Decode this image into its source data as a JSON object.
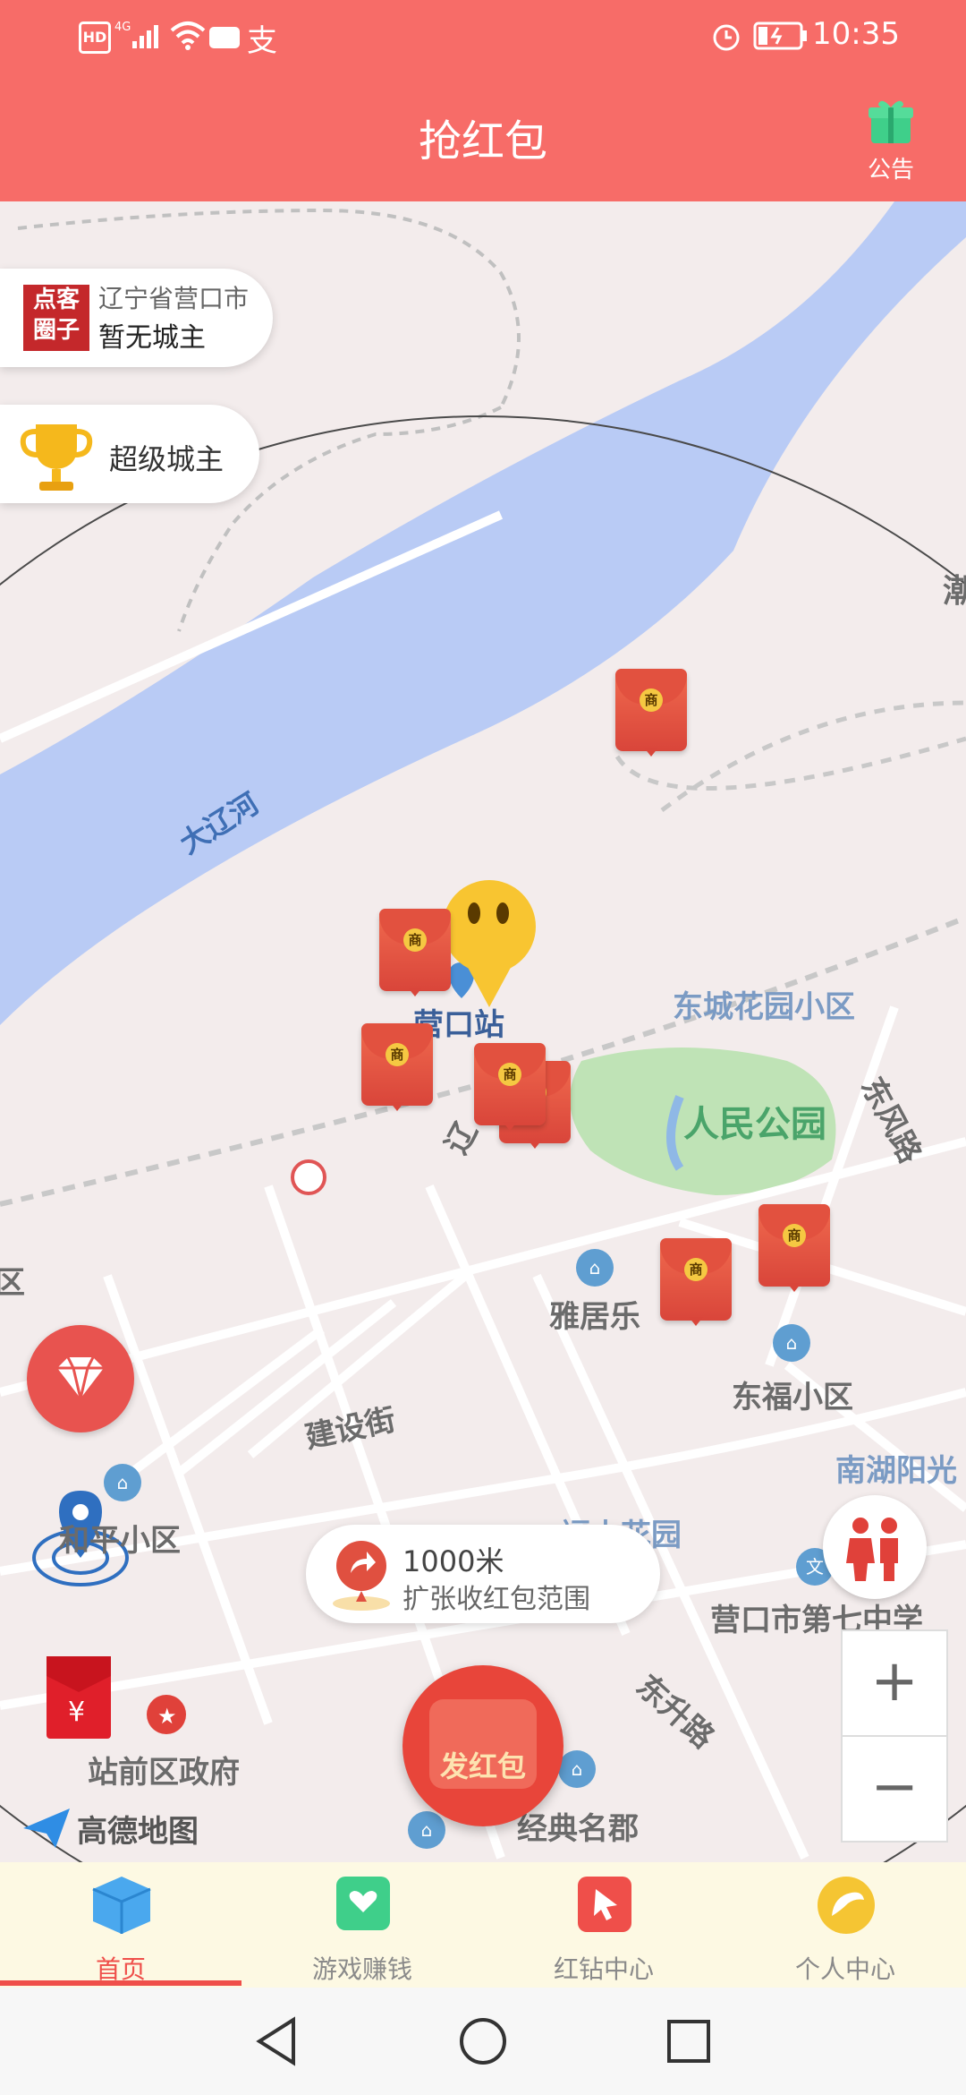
{
  "status_bar": {
    "left_icons": [
      "hd-icon",
      "4g-signal-icon",
      "wifi-icon",
      "huawei-icon",
      "alipay-icon"
    ],
    "right_icons": [
      "alarm-icon",
      "battery-icon"
    ],
    "time": "10:35"
  },
  "header": {
    "title": "抢红包",
    "notice_label": "公告"
  },
  "city_card": {
    "logo_text": "点客圈子",
    "location": "辽宁省营口市",
    "owner_status": "暂无城主"
  },
  "super_card": {
    "label": "超级城主"
  },
  "map_labels": {
    "river": "大辽河",
    "station": "营口站",
    "east_city": "东城花园小区",
    "park": "人民公园",
    "dongfeng_road": "东风路",
    "yajule": "雅居乐",
    "dongfu": "东福小区",
    "jianshe": "建设街",
    "nanhu": "南湖阳光",
    "fushan": "福山花园",
    "heping": "和平小区",
    "no7school": "营口市第七中学",
    "zhanqian": "站前区政府",
    "dongsheng": "东升路",
    "jingdian": "经典名郡",
    "liao": "辽",
    "edge_chao": "潮",
    "edge_qu": "区",
    "amap": "高德地图"
  },
  "envelope_badge": "商",
  "range_bubble": {
    "distance": "1000米",
    "action": "扩张收红包范围"
  },
  "send_button": "发红包",
  "zoom": {
    "in": "+",
    "out": "−"
  },
  "bottom_nav": [
    {
      "label": "首页",
      "icon": "box-icon",
      "active": true
    },
    {
      "label": "游戏赚钱",
      "icon": "heart-mail-icon",
      "active": false
    },
    {
      "label": "红钻中心",
      "icon": "cursor-icon",
      "active": false
    },
    {
      "label": "个人中心",
      "icon": "profile-icon",
      "active": false
    }
  ],
  "system_nav": [
    "back-icon",
    "home-icon",
    "recents-icon"
  ],
  "colors": {
    "header": "#f76c68",
    "envelope": "#e2513f",
    "active_tab": "#ef4f4a",
    "river": "#b9cbf5",
    "park": "#bfe3b6"
  }
}
